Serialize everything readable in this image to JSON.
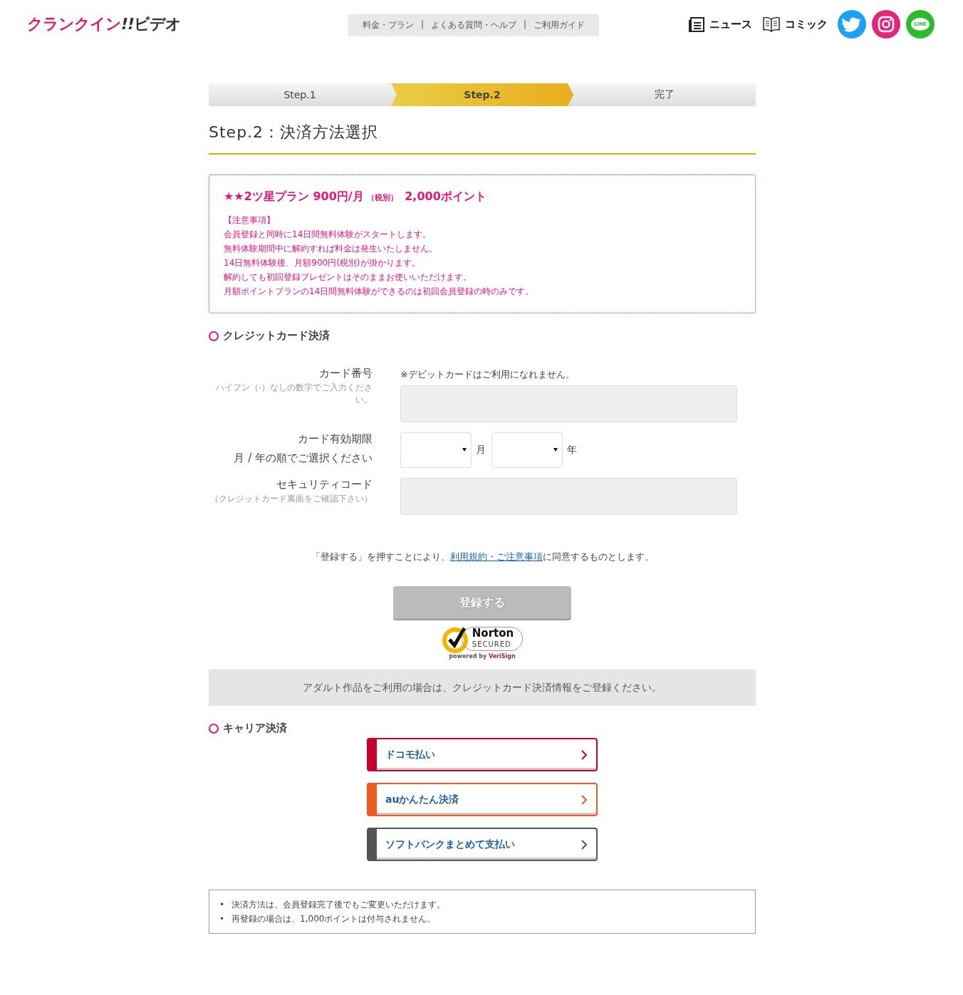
{
  "logo": {
    "brand": "クランクイン",
    "mark": "!!",
    "suffix": "ビデオ"
  },
  "nav": [
    "料金・プラン",
    "よくある質問・ヘルプ",
    "ご利用ガイド"
  ],
  "nav_separator": "|",
  "header_links": [
    {
      "kind": "news",
      "label": "ニュース"
    },
    {
      "kind": "comic",
      "label": "コミック"
    }
  ],
  "social": [
    {
      "kind": "twitter",
      "color": "#1da1f2"
    },
    {
      "kind": "instagram",
      "color": "#e4257c"
    },
    {
      "kind": "line",
      "color": "#2dbb2d",
      "label": "LINE"
    }
  ],
  "steps": [
    {
      "label": "Step.1",
      "selected": false
    },
    {
      "label": "Step.2",
      "selected": true
    },
    {
      "label": "完了",
      "selected": false
    }
  ],
  "page_title": "Step.2：決済方法選択",
  "plan": {
    "title": "★★2ツ星プラン 900円/月",
    "tax": "（税別）",
    "points": "2,000ポイント",
    "notes": [
      "【注意事項】",
      "会員登録と同時に14日間無料体験がスタートします。",
      "無料体験期間中に解約すれば料金は発生いたしません。",
      "14日無料体験後、月額900円(税別)が掛かります。",
      "解約しても初回登録プレゼントはそのままお使いいただけます。",
      "月額ポイントプランの14日間無料体験ができるのは初回会員登録の時のみです。"
    ]
  },
  "credit": {
    "heading": "クレジットカード決済",
    "card_number": {
      "label": "カード番号",
      "hint": "ハイフン（-）なしの数字でご入力ください。",
      "note": "※デビットカードはご利用になれません。"
    },
    "expiry": {
      "label": "カード有効期限",
      "hint": "月 / 年の順でご選択ください",
      "month_unit": "月",
      "year_unit": "年"
    },
    "security": {
      "label": "セキュリティコード",
      "hint": "（クレジットカード裏面をご確認下さい）"
    },
    "agree_before": "「登録する」を押すことにより、",
    "agree_link": "利用規約・ご注意事項",
    "agree_after": "に同意するものとします。",
    "submit": {
      "label": "登録する",
      "disabled": true
    },
    "seal": {
      "name": "Norton",
      "secured": "SECURED",
      "powered": "powered by",
      "by": "VeriSign"
    },
    "adult_notice": "アダルト作品をご利用の場合は、クレジットカード決済情報をご登録ください。"
  },
  "carrier": {
    "heading": "キャリア決済",
    "options": [
      {
        "label": "ドコモ払い",
        "color": "#c8002d"
      },
      {
        "label": "auかんたん決済",
        "color": "#f05a22"
      },
      {
        "label": "ソフトバンクまとめて支払い",
        "color": "#555555"
      }
    ]
  },
  "footer_bullet": "•",
  "footer_notes": [
    "決済方法は、会員登録完了後でもご変更いただけます。",
    "再登録の場合は、1,000ポイントは付与されません。"
  ]
}
